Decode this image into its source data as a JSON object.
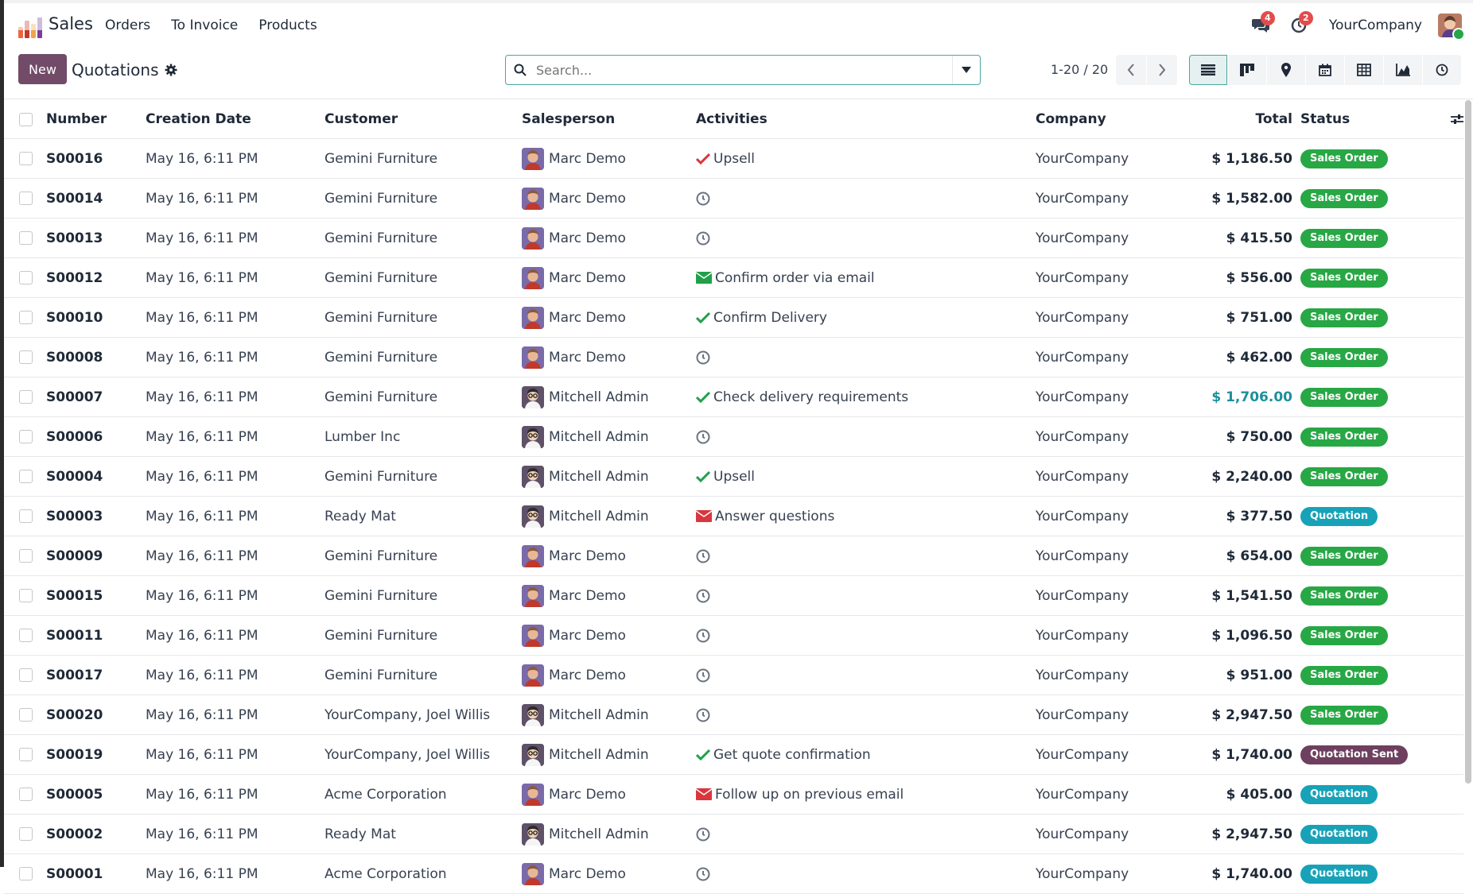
{
  "navbar": {
    "app_name": "Sales",
    "menu": [
      "Orders",
      "To Invoice",
      "Products"
    ],
    "messages_count": "4",
    "activities_count": "2",
    "company": "YourCompany"
  },
  "control": {
    "new_label": "New",
    "breadcrumb": "Quotations",
    "search_placeholder": "Search...",
    "pager": "1-20 / 20"
  },
  "table": {
    "headers": {
      "number": "Number",
      "date": "Creation Date",
      "customer": "Customer",
      "salesperson": "Salesperson",
      "activities": "Activities",
      "company": "Company",
      "total": "Total",
      "status": "Status"
    },
    "rows": [
      {
        "number": "S00016",
        "date": "May 16, 6:11 PM",
        "customer": "Gemini Furniture",
        "salesperson": "Marc Demo",
        "activity_icon": "check-red",
        "activity": "Upsell",
        "company": "YourCompany",
        "total": "$ 1,186.50",
        "status": "Sales Order"
      },
      {
        "number": "S00014",
        "date": "May 16, 6:11 PM",
        "customer": "Gemini Furniture",
        "salesperson": "Marc Demo",
        "activity_icon": "clock",
        "activity": "",
        "company": "YourCompany",
        "total": "$ 1,582.00",
        "status": "Sales Order"
      },
      {
        "number": "S00013",
        "date": "May 16, 6:11 PM",
        "customer": "Gemini Furniture",
        "salesperson": "Marc Demo",
        "activity_icon": "clock",
        "activity": "",
        "company": "YourCompany",
        "total": "$ 415.50",
        "status": "Sales Order"
      },
      {
        "number": "S00012",
        "date": "May 16, 6:11 PM",
        "customer": "Gemini Furniture",
        "salesperson": "Marc Demo",
        "activity_icon": "email-green",
        "activity": "Confirm order via email",
        "company": "YourCompany",
        "total": "$ 556.00",
        "status": "Sales Order"
      },
      {
        "number": "S00010",
        "date": "May 16, 6:11 PM",
        "customer": "Gemini Furniture",
        "salesperson": "Marc Demo",
        "activity_icon": "check-green",
        "activity": "Confirm Delivery",
        "company": "YourCompany",
        "total": "$ 751.00",
        "status": "Sales Order"
      },
      {
        "number": "S00008",
        "date": "May 16, 6:11 PM",
        "customer": "Gemini Furniture",
        "salesperson": "Marc Demo",
        "activity_icon": "clock",
        "activity": "",
        "company": "YourCompany",
        "total": "$ 462.00",
        "status": "Sales Order"
      },
      {
        "number": "S00007",
        "date": "May 16, 6:11 PM",
        "customer": "Gemini Furniture",
        "salesperson": "Mitchell Admin",
        "activity_icon": "check-green",
        "activity": "Check delivery requirements",
        "company": "YourCompany",
        "total": "$ 1,706.00",
        "status": "Sales Order",
        "highlight": true
      },
      {
        "number": "S00006",
        "date": "May 16, 6:11 PM",
        "customer": "Lumber Inc",
        "salesperson": "Mitchell Admin",
        "activity_icon": "clock",
        "activity": "",
        "company": "YourCompany",
        "total": "$ 750.00",
        "status": "Sales Order"
      },
      {
        "number": "S00004",
        "date": "May 16, 6:11 PM",
        "customer": "Gemini Furniture",
        "salesperson": "Mitchell Admin",
        "activity_icon": "check-green",
        "activity": "Upsell",
        "company": "YourCompany",
        "total": "$ 2,240.00",
        "status": "Sales Order"
      },
      {
        "number": "S00003",
        "date": "May 16, 6:11 PM",
        "customer": "Ready Mat",
        "salesperson": "Mitchell Admin",
        "activity_icon": "email-red",
        "activity": "Answer questions",
        "company": "YourCompany",
        "total": "$ 377.50",
        "status": "Quotation"
      },
      {
        "number": "S00009",
        "date": "May 16, 6:11 PM",
        "customer": "Gemini Furniture",
        "salesperson": "Marc Demo",
        "activity_icon": "clock",
        "activity": "",
        "company": "YourCompany",
        "total": "$ 654.00",
        "status": "Sales Order"
      },
      {
        "number": "S00015",
        "date": "May 16, 6:11 PM",
        "customer": "Gemini Furniture",
        "salesperson": "Marc Demo",
        "activity_icon": "clock",
        "activity": "",
        "company": "YourCompany",
        "total": "$ 1,541.50",
        "status": "Sales Order"
      },
      {
        "number": "S00011",
        "date": "May 16, 6:11 PM",
        "customer": "Gemini Furniture",
        "salesperson": "Marc Demo",
        "activity_icon": "clock",
        "activity": "",
        "company": "YourCompany",
        "total": "$ 1,096.50",
        "status": "Sales Order"
      },
      {
        "number": "S00017",
        "date": "May 16, 6:11 PM",
        "customer": "Gemini Furniture",
        "salesperson": "Marc Demo",
        "activity_icon": "clock",
        "activity": "",
        "company": "YourCompany",
        "total": "$ 951.00",
        "status": "Sales Order"
      },
      {
        "number": "S00020",
        "date": "May 16, 6:11 PM",
        "customer": "YourCompany, Joel Willis",
        "salesperson": "Mitchell Admin",
        "activity_icon": "clock",
        "activity": "",
        "company": "YourCompany",
        "total": "$ 2,947.50",
        "status": "Sales Order"
      },
      {
        "number": "S00019",
        "date": "May 16, 6:11 PM",
        "customer": "YourCompany, Joel Willis",
        "salesperson": "Mitchell Admin",
        "activity_icon": "check-green",
        "activity": "Get quote confirmation",
        "company": "YourCompany",
        "total": "$ 1,740.00",
        "status": "Quotation Sent"
      },
      {
        "number": "S00005",
        "date": "May 16, 6:11 PM",
        "customer": "Acme Corporation",
        "salesperson": "Marc Demo",
        "activity_icon": "email-red",
        "activity": "Follow up on previous email",
        "company": "YourCompany",
        "total": "$ 405.00",
        "status": "Quotation"
      },
      {
        "number": "S00002",
        "date": "May 16, 6:11 PM",
        "customer": "Ready Mat",
        "salesperson": "Mitchell Admin",
        "activity_icon": "clock",
        "activity": "",
        "company": "YourCompany",
        "total": "$ 2,947.50",
        "status": "Quotation"
      },
      {
        "number": "S00001",
        "date": "May 16, 6:11 PM",
        "customer": "Acme Corporation",
        "salesperson": "Marc Demo",
        "activity_icon": "clock",
        "activity": "",
        "company": "YourCompany",
        "total": "$ 1,740.00",
        "status": "Quotation"
      }
    ]
  },
  "colors": {
    "primary": "#714b67",
    "accent": "#4aa69f",
    "sales_order": "#28a745",
    "quotation": "#17a2b8",
    "quotation_sent": "#6e3f5e"
  }
}
